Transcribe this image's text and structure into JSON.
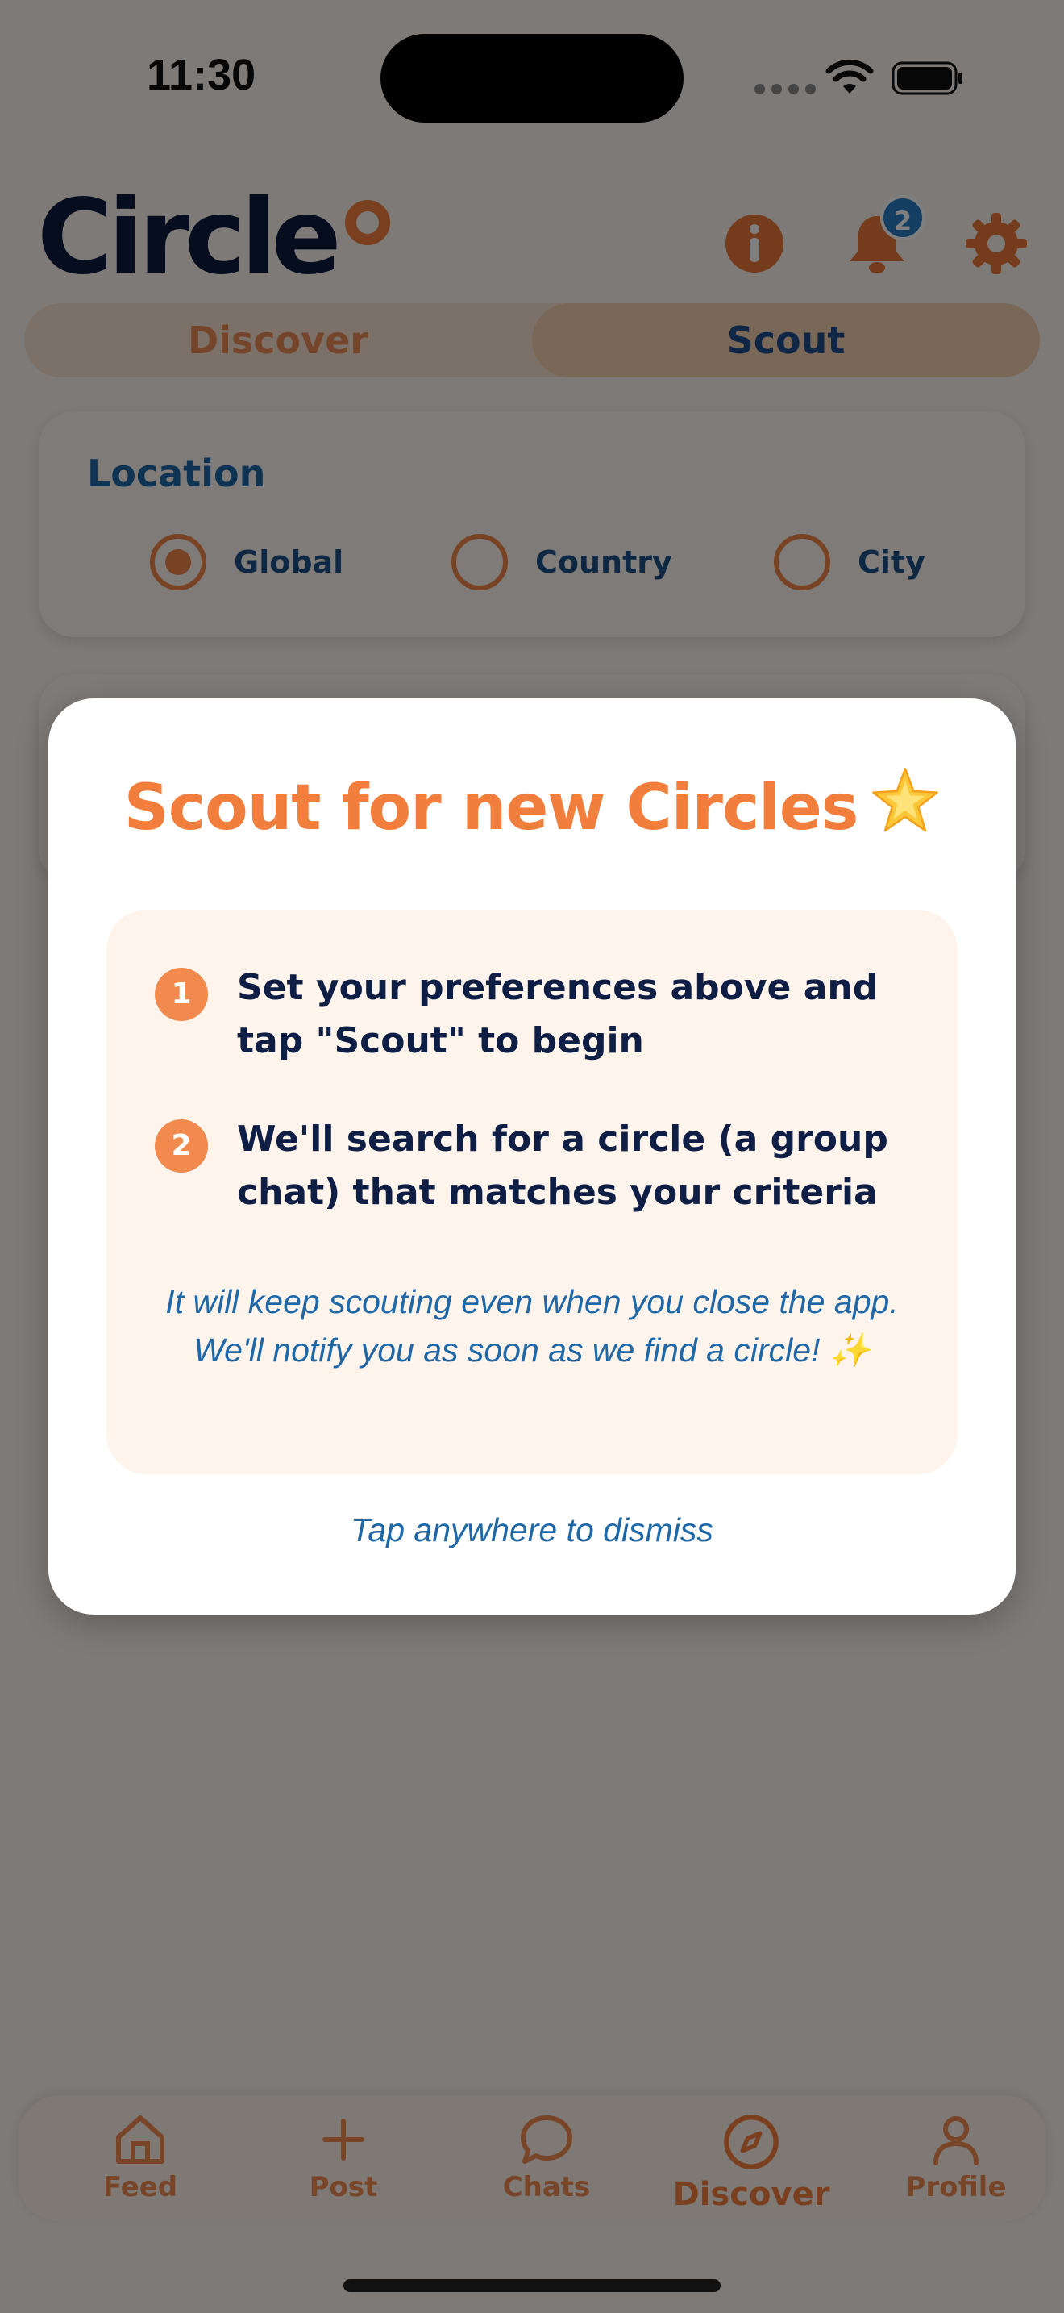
{
  "status_bar": {
    "time": "11:30"
  },
  "header": {
    "logo_text": "Circle",
    "notification_count": "2"
  },
  "segmented": {
    "discover_label": "Discover",
    "scout_label": "Scout",
    "selected": "Scout"
  },
  "location": {
    "title": "Location",
    "options": [
      {
        "label": "Global",
        "selected": true
      },
      {
        "label": "Country",
        "selected": false
      },
      {
        "label": "City",
        "selected": false
      }
    ]
  },
  "modal": {
    "title": "Scout for new Circles",
    "title_emoji": "star-icon",
    "steps": [
      {
        "num": "1",
        "text": "Set your preferences above and tap \"Scout\" to begin"
      },
      {
        "num": "2",
        "text": "We'll search for a circle (a group chat) that matches your criteria"
      }
    ],
    "note": "It will keep scouting even when you close the app. We'll notify you as soon as we find a circle! ✨",
    "dismiss": "Tap anywhere to dismiss"
  },
  "tabbar": {
    "items": [
      {
        "label": "Feed",
        "icon": "home-icon"
      },
      {
        "label": "Post",
        "icon": "plus-icon"
      },
      {
        "label": "Chats",
        "icon": "chat-bubble-icon"
      },
      {
        "label": "Discover",
        "icon": "compass-icon",
        "active": true
      },
      {
        "label": "Profile",
        "icon": "person-icon"
      }
    ]
  },
  "colors": {
    "accent": "#f27e3d",
    "navy": "#0d1b3d",
    "blue": "#1f68a8",
    "badge": "#2a7fc5"
  }
}
